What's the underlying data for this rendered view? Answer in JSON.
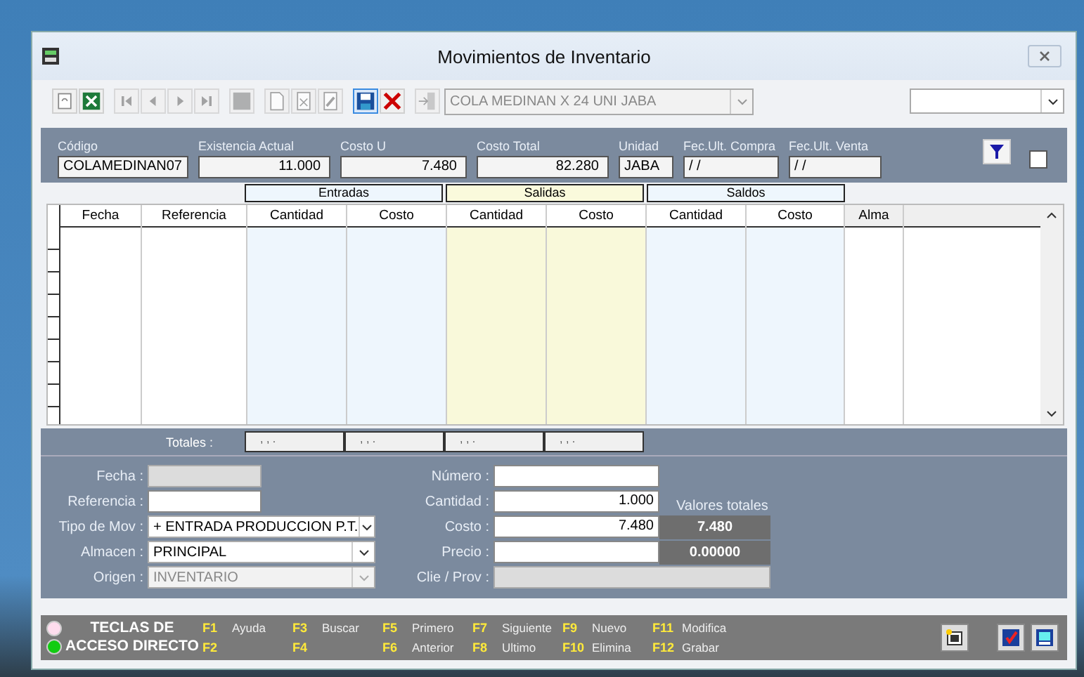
{
  "window": {
    "title": "Movimientos de Inventario"
  },
  "toolbar": {
    "buttons": [
      {
        "kind": "refresh",
        "selected": false,
        "disabled": false
      },
      {
        "kind": "excel",
        "selected": false,
        "disabled": false
      },
      {
        "kind": "first",
        "selected": false,
        "disabled": true
      },
      {
        "kind": "prev",
        "selected": false,
        "disabled": true
      },
      {
        "kind": "next",
        "selected": false,
        "disabled": true
      },
      {
        "kind": "last",
        "selected": false,
        "disabled": true
      },
      {
        "kind": "stop",
        "selected": false,
        "disabled": true
      },
      {
        "kind": "new",
        "selected": false,
        "disabled": true
      },
      {
        "kind": "delete",
        "selected": false,
        "disabled": true
      },
      {
        "kind": "edit",
        "selected": false,
        "disabled": true
      },
      {
        "kind": "save",
        "selected": true,
        "disabled": false
      },
      {
        "kind": "cancel",
        "selected": false,
        "disabled": false
      },
      {
        "kind": "exit",
        "selected": false,
        "disabled": true
      }
    ],
    "product": {
      "value": "COLA MEDINAN X 24 UNI JABA",
      "disabled": true
    }
  },
  "header_fields": [
    {
      "label": "Código",
      "value": "COLAMEDINAN07",
      "kind": "text"
    },
    {
      "label": "Existencia Actual",
      "value": "11.000",
      "kind": "number"
    },
    {
      "label": "Costo U",
      "value": "7.480",
      "kind": "number"
    },
    {
      "label": "Costo Total",
      "value": "82.280",
      "kind": "number"
    },
    {
      "label": "Unidad",
      "value": "JABA",
      "kind": "text"
    },
    {
      "label": "Fec.Ult. Compra",
      "value": " / /",
      "kind": "text"
    },
    {
      "label": "Fec.Ult. Venta",
      "value": " / /",
      "kind": "text"
    }
  ],
  "filter_checkbox": {
    "checked": false
  },
  "column_groups": [
    {
      "label": "Entradas",
      "color": "#eef6fd"
    },
    {
      "label": "Salidas",
      "color": "#fafadc"
    },
    {
      "label": "Saldos",
      "color": "#eef6fd"
    }
  ],
  "table": {
    "columns": [
      {
        "label": "Fecha"
      },
      {
        "label": "Referencia"
      },
      {
        "label": "Cantidad",
        "color": "#eef6fd"
      },
      {
        "label": "Costo",
        "color": "#eef6fd"
      },
      {
        "label": "Cantidad",
        "color": "#f9f9da"
      },
      {
        "label": "Costo",
        "color": "#f9f9da"
      },
      {
        "label": "Cantidad",
        "color": "#eef6fd"
      },
      {
        "label": "Costo",
        "color": "#eef6fd"
      },
      {
        "label": "Alma"
      }
    ]
  },
  "totals": {
    "label": "Totales :",
    "values": [
      ", , .",
      ", , .",
      ", , .",
      ", , ."
    ]
  },
  "form": {
    "left": [
      {
        "label": "Fecha :",
        "kind": "text",
        "disabled": true
      },
      {
        "label": "Referencia :",
        "kind": "text",
        "disabled": false
      },
      {
        "label": "Tipo de Mov :",
        "kind": "combo",
        "value": "+ ENTRADA PRODUCCION P.T.",
        "disabled": false
      },
      {
        "label": "Almacen :",
        "kind": "combo",
        "value": "PRINCIPAL",
        "disabled": false
      },
      {
        "label": "Origen :",
        "kind": "combo",
        "value": "INVENTARIO",
        "disabled": true
      }
    ],
    "right": [
      {
        "label": "Número :",
        "disabled": false
      },
      {
        "label": "Cantidad :",
        "value": "1.000",
        "disabled": false
      },
      {
        "label": "Costo :",
        "value": "7.480",
        "disabled": false,
        "total": "7.480"
      },
      {
        "label": "Precio :",
        "disabled": false,
        "total": "0.00000"
      },
      {
        "label": "Clie / Prov :",
        "disabled": true,
        "wide": true
      }
    ],
    "totals_title": "Valores totales"
  },
  "shortcuts": {
    "lights": [
      {
        "on": false
      },
      {
        "on": true
      }
    ],
    "title": [
      "TECLAS DE",
      "ACCESO DIRECTO"
    ],
    "keys": [
      {
        "key": "F1",
        "action": "Ayuda"
      },
      {
        "key": "F2"
      },
      {
        "key": "F3",
        "action": "Buscar"
      },
      {
        "key": "F4"
      },
      {
        "key": "F5",
        "action": "Primero"
      },
      {
        "key": "F6",
        "action": "Anterior"
      },
      {
        "key": "F7",
        "action": "Siguiente"
      },
      {
        "key": "F8",
        "action": "Ultimo"
      },
      {
        "key": "F9",
        "action": "Nuevo"
      },
      {
        "key": "F10",
        "action": "Elimina"
      },
      {
        "key": "F11",
        "action": "Modifica"
      },
      {
        "key": "F12",
        "action": "Grabar"
      }
    ]
  }
}
